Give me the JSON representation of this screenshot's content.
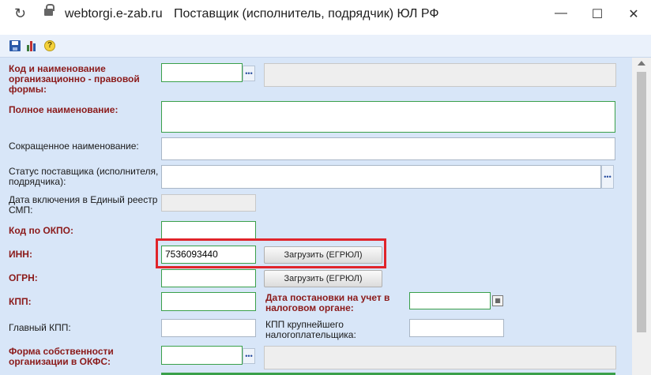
{
  "browser": {
    "url": "webtorgi.e-zab.ru",
    "window_title": "Поставщик (исполнитель, подрядчик) ЮЛ РФ",
    "minimize": "—",
    "maximize": "☐",
    "close": "✕"
  },
  "colors": {
    "form_bg": "#d8e6f8",
    "required_label": "#8b1a1a",
    "required_border": "#3aa04a",
    "highlight": "#e0242b"
  },
  "fields": {
    "opf": {
      "label": "Код и наименование организационно - правовой формы:",
      "value": "",
      "name_value": ""
    },
    "full_name": {
      "label": "Полное наименование:",
      "value": ""
    },
    "short_name": {
      "label": "Сокращенное наименование:",
      "value": ""
    },
    "status": {
      "label": "Статус поставщика (исполнителя, подрядчика):",
      "value": ""
    },
    "smp_date": {
      "label": "Дата включения в Единый реестр СМП:",
      "value": ""
    },
    "okpo": {
      "label": "Код по ОКПО:",
      "value": ""
    },
    "inn": {
      "label": "ИНН:",
      "value": "7536093440",
      "button": "Загрузить (ЕГРЮЛ)"
    },
    "ogrn": {
      "label": "ОГРН:",
      "value": "",
      "button": "Загрузить (ЕГРЮЛ)"
    },
    "kpp": {
      "label": "КПП:",
      "value": ""
    },
    "tax_date": {
      "label": "Дата постановки на учет в налоговом органе:",
      "value": ""
    },
    "main_kpp": {
      "label": "Главный КПП:",
      "value": ""
    },
    "largest_kpp": {
      "label": "КПП крупнейшего налогоплательщика:",
      "value": ""
    },
    "okfs": {
      "label": "Форма собственности организации в ОКФС:",
      "value": "",
      "name_value": ""
    }
  }
}
